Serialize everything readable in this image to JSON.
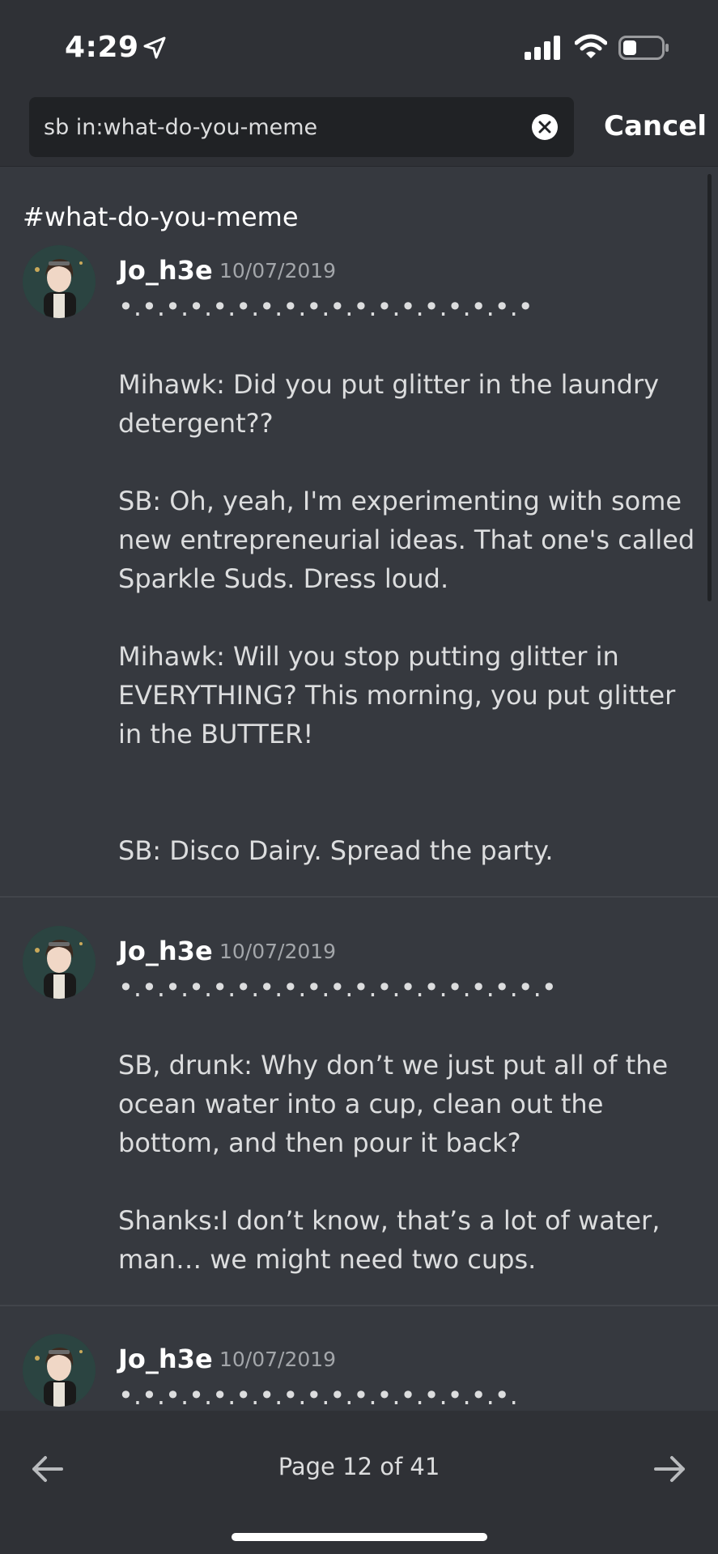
{
  "status": {
    "time": "4:29",
    "icons": [
      "location-arrow-icon",
      "cellular-signal-icon",
      "wifi-icon",
      "battery-icon"
    ]
  },
  "search": {
    "query": "sb in:what-do-you-meme",
    "cancel_label": "Cancel"
  },
  "channel": "#what-do-you-meme",
  "messages": [
    {
      "author": "Jo_h3e",
      "date": "10/07/2019",
      "text": "•.•.•.•.•.•.•.•.•.•.•.•.•.•.•.•.•.•\n\nMihawk: Did you put glitter in the laundry detergent??\n\nSB: Oh, yeah, I'm experimenting with some new entrepreneurial ideas. That one's called Sparkle Suds. Dress loud.\n\nMihawk: Will you stop putting glitter in EVERYTHING? This morning, you put glitter in the BUTTER!\n\n\nSB: Disco Dairy. Spread the party."
    },
    {
      "author": "Jo_h3e",
      "date": "10/07/2019",
      "text": "•.•.•.•.•.•.•.•.•.•.•.•.•.•.•.•.•.•.•\n\nSB, drunk: Why don’t we just put all of the ocean water into a cup, clean out the bottom, and then pour it back?\n\nShanks:I don’t know, that’s a lot of water, man… we might need two cups."
    },
    {
      "author": "Jo_h3e",
      "date": "10/07/2019",
      "text": "•.•.•.•.•.•.•.•.•.•.•.•.•.•.•.•.•."
    }
  ],
  "pagination": {
    "label": "Page 12 of 41"
  },
  "colors": {
    "background": "#36393f",
    "header": "#2f3136",
    "input": "#202225",
    "text": "#dcddde",
    "muted": "#a3a6aa"
  }
}
